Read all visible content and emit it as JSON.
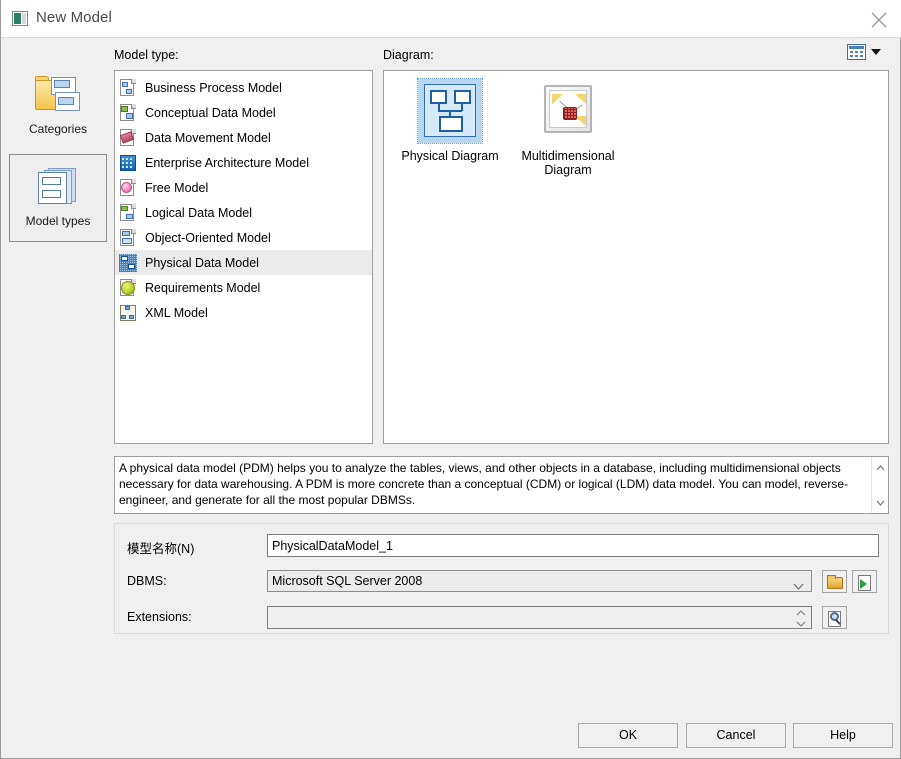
{
  "window": {
    "title": "New Model",
    "title_icon": "model-window-icon",
    "close_icon": "close-icon"
  },
  "toolbar": {
    "view_switcher_icon": "grid-view-icon",
    "view_switcher_caret_icon": "chevron-down-icon"
  },
  "labels": {
    "model_type": "Model type:",
    "diagram": "Diagram:"
  },
  "rail": {
    "tabs": [
      {
        "label": "Categories",
        "icon": "categories-folder-icon",
        "selected": false
      },
      {
        "label": "Model types",
        "icon": "model-types-stack-icon",
        "selected": true
      }
    ]
  },
  "model_types": {
    "items": [
      {
        "label": "Business Process Model",
        "icon": "business-process-model-icon",
        "selected": false
      },
      {
        "label": "Conceptual Data Model",
        "icon": "conceptual-data-model-icon",
        "selected": false
      },
      {
        "label": "Data Movement Model",
        "icon": "data-movement-model-icon",
        "selected": false
      },
      {
        "label": "Enterprise Architecture Model",
        "icon": "enterprise-architecture-model-icon",
        "selected": false
      },
      {
        "label": "Free Model",
        "icon": "free-model-icon",
        "selected": false
      },
      {
        "label": "Logical Data Model",
        "icon": "logical-data-model-icon",
        "selected": false
      },
      {
        "label": "Object-Oriented Model",
        "icon": "object-oriented-model-icon",
        "selected": false
      },
      {
        "label": "Physical Data Model",
        "icon": "physical-data-model-icon",
        "selected": true
      },
      {
        "label": "Requirements Model",
        "icon": "requirements-model-icon",
        "selected": false
      },
      {
        "label": "XML Model",
        "icon": "xml-model-icon",
        "selected": false
      }
    ]
  },
  "diagrams": {
    "items": [
      {
        "label": "Physical Diagram",
        "icon": "physical-diagram-icon",
        "selected": true
      },
      {
        "label": "Multidimensional Diagram",
        "icon": "multidimensional-diagram-icon",
        "selected": false
      }
    ]
  },
  "description": {
    "text": "A physical data model (PDM) helps you to analyze the tables, views, and other objects in a database, including multidimensional objects necessary for data warehousing. A PDM is more concrete than a conceptual (CDM) or logical (LDM) data model. You can model, reverse-engineer, and generate for all the most popular DBMSs.",
    "scroll_up_icon": "chevron-up-icon",
    "scroll_down_icon": "chevron-down-icon"
  },
  "form": {
    "name_label": "模型名称(N)",
    "name_value": "PhysicalDataModel_1",
    "name_placeholder": "",
    "dbms_label": "DBMS:",
    "dbms_value": "Microsoft SQL Server 2008",
    "dbms_caret_icon": "chevron-down-icon",
    "dbms_browse_icon": "folder-icon",
    "dbms_open_icon": "page-open-icon",
    "extensions_label": "Extensions:",
    "extensions_value": "",
    "extensions_spinner_icon": "spinner-updown-icon",
    "extensions_browse_icon": "magnifier-page-icon"
  },
  "buttons": {
    "ok": "OK",
    "cancel": "Cancel",
    "help": "Help"
  },
  "colors": {
    "dialog_bg": "#f0f0f0",
    "panel_bg": "#ffffff",
    "selection": "#b7d6f0",
    "row_selected": "#ebebeb",
    "border": "#a0a0a0"
  }
}
